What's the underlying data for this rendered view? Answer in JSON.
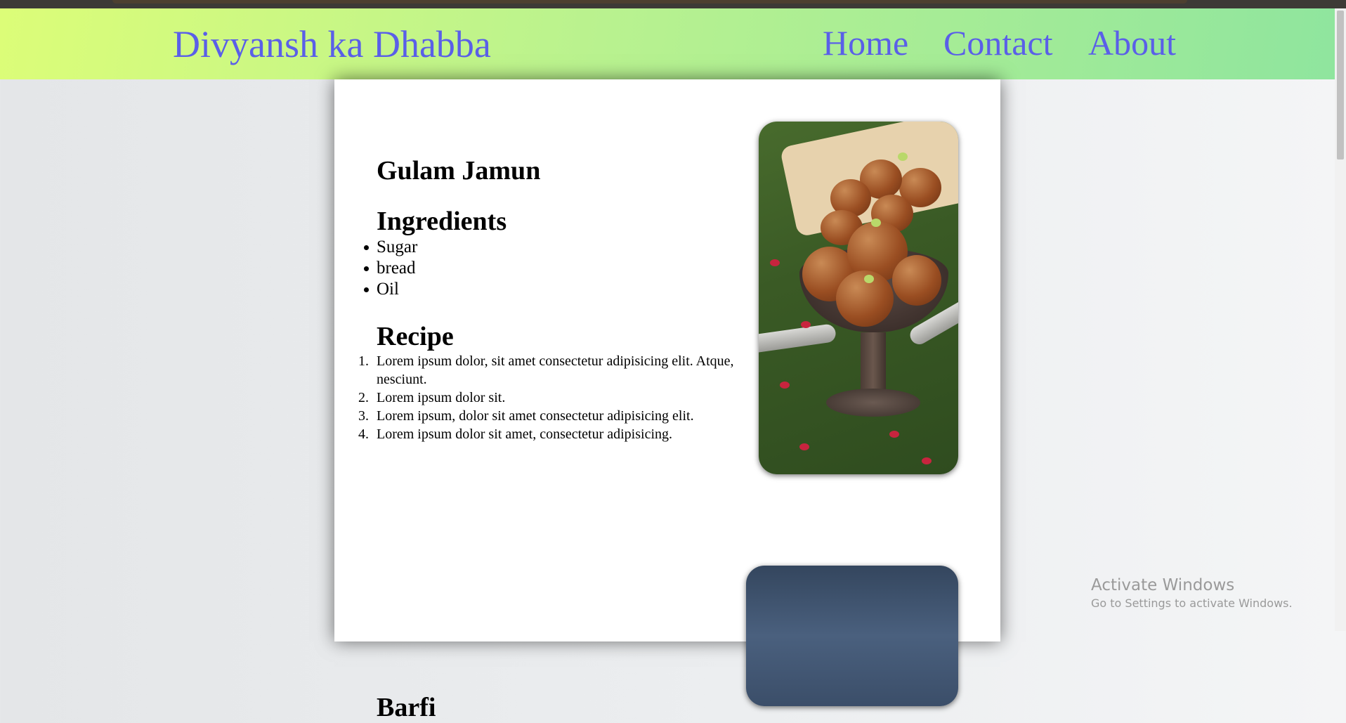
{
  "header": {
    "brand": "Divyansh ka Dhabba",
    "nav": {
      "home": "Home",
      "contact": "Contact",
      "about": "About"
    }
  },
  "recipes": [
    {
      "title": "Gulam Jamun",
      "ingredients_heading": "Ingredients",
      "ingredients": [
        "Sugar",
        "bread",
        "Oil"
      ],
      "recipe_heading": "Recipe",
      "steps": [
        "Lorem ipsum dolor, sit amet consectetur adipisicing elit. Atque, nesciunt.",
        "Lorem ipsum dolor sit.",
        "Lorem ipsum, dolor sit amet consectetur adipisicing elit.",
        "Lorem ipsum dolor sit amet, consectetur adipisicing."
      ]
    },
    {
      "title": "Barfi"
    }
  ],
  "watermark": {
    "line1": "Activate Windows",
    "line2": "Go to Settings to activate Windows."
  },
  "colors": {
    "nav_text": "#5a5fe8",
    "nav_gradient_start": "#dcfd78",
    "nav_gradient_end": "#8fe59e"
  }
}
